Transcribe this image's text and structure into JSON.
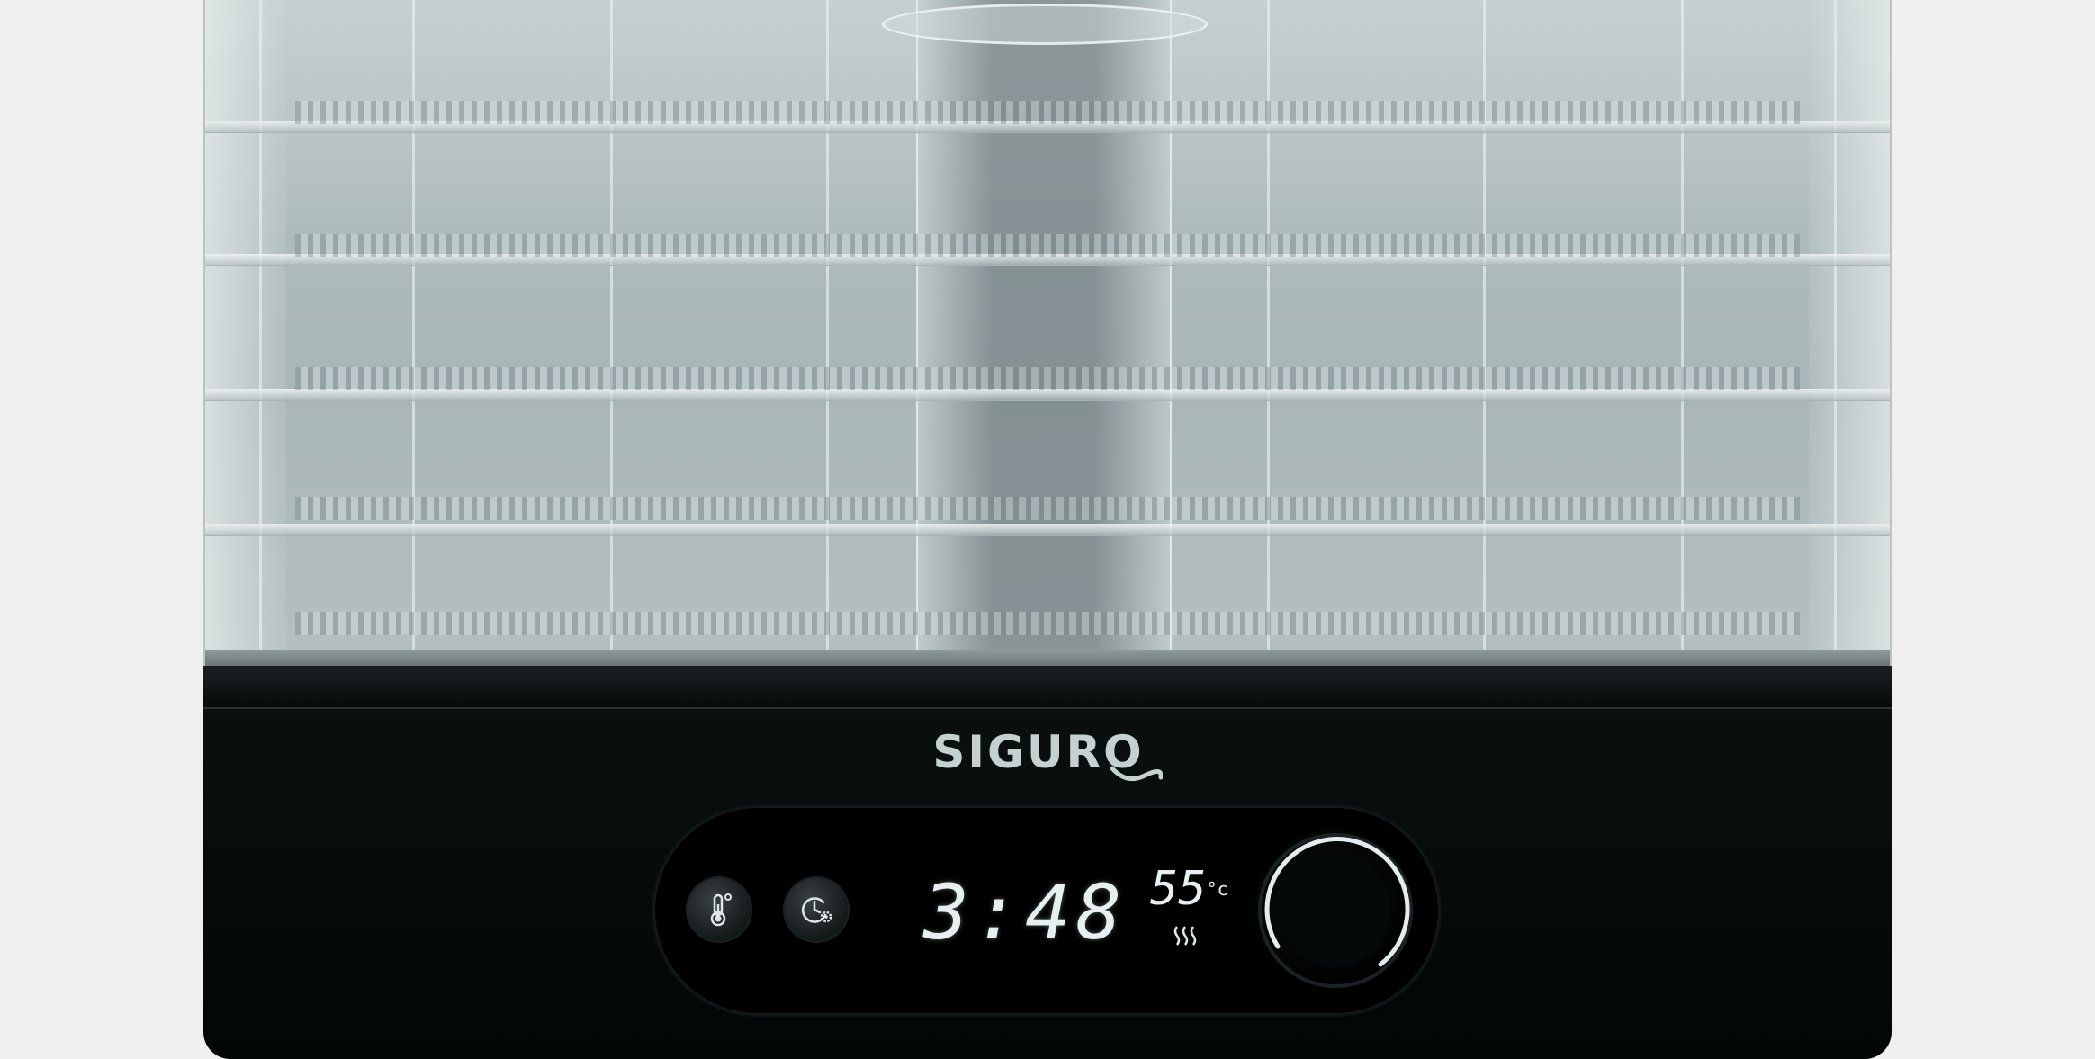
{
  "product": {
    "brand": "SIGURO",
    "display": {
      "time": "3:48",
      "temperature": "55",
      "temperature_unit": "°c"
    }
  },
  "icons": {
    "temperature_button": "thermometer-icon",
    "timer_button": "clock-settings-icon",
    "heating_indicator": "heat-waves-icon",
    "dial": "control-knob"
  },
  "colors": {
    "background": "#efefef",
    "base": "#020606",
    "display_text": "#e7eff0",
    "logo": "#c5d0d1"
  }
}
